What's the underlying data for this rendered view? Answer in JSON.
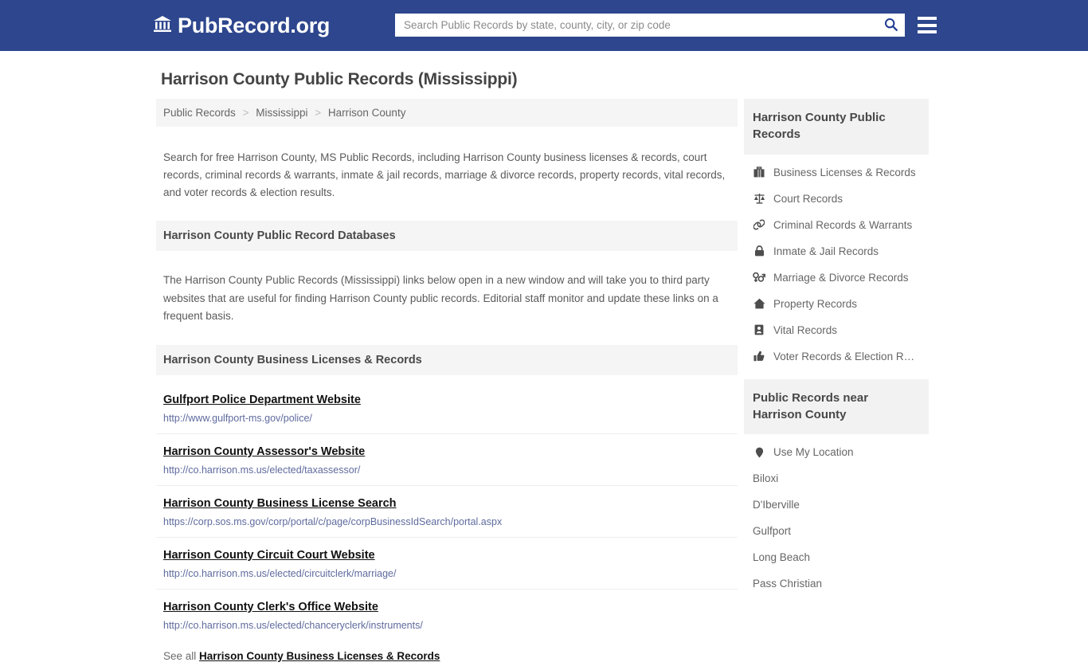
{
  "header": {
    "brand_name": "PubRecord.org",
    "brand_icon": "bank-icon",
    "search_placeholder": "Search Public Records by state, county, city, or zip code",
    "search_value": "",
    "search_icon": "search-icon",
    "menu_icon": "hamburger-menu-icon",
    "brand_color": "#2d468d"
  },
  "page": {
    "title": "Harrison County Public Records (Mississippi)"
  },
  "breadcrumb": {
    "items": [
      "Public Records",
      "Mississippi",
      "Harrison County"
    ],
    "separator": ">"
  },
  "intro": {
    "text": "Search for free Harrison County, MS Public Records, including Harrison County business licenses & records, court records, criminal records & warrants, inmate & jail records, marriage & divorce records, property records, vital records, and voter records & election results."
  },
  "databases_section": {
    "heading": "Harrison County Public Record Databases",
    "body": "The Harrison County Public Records (Mississippi) links below open in a new window and will take you to third party websites that are useful for finding Harrison County public records. Editorial staff monitor and update these links on a frequent basis."
  },
  "business_section": {
    "heading": "Harrison County Business Licenses & Records",
    "links": [
      {
        "title": "Gulfport Police Department Website",
        "url": "http://www.gulfport-ms.gov/police/"
      },
      {
        "title": "Harrison County Assessor's Website",
        "url": "http://co.harrison.ms.us/elected/taxassessor/"
      },
      {
        "title": "Harrison County Business License Search",
        "url": "https://corp.sos.ms.gov/corp/portal/c/page/corpBusinessIdSearch/portal.aspx"
      },
      {
        "title": "Harrison County Circuit Court Website",
        "url": "http://co.harrison.ms.us/elected/circuitclerk/marriage/"
      },
      {
        "title": "Harrison County Clerk's Office Website",
        "url": "http://co.harrison.ms.us/elected/chanceryclerk/instruments/"
      }
    ],
    "see_all_prefix": "See all",
    "see_all_link": "Harrison County Business Licenses & Records"
  },
  "sidebar": {
    "records_box": {
      "heading": "Harrison County Public Records",
      "items": [
        {
          "label": "Business Licenses & Records",
          "icon": "briefcase-icon"
        },
        {
          "label": "Court Records",
          "icon": "scales-icon"
        },
        {
          "label": "Criminal Records & Warrants",
          "icon": "handcuffs-icon"
        },
        {
          "label": "Inmate & Jail Records",
          "icon": "lock-icon"
        },
        {
          "label": "Marriage & Divorce Records",
          "icon": "venus-mars-icon"
        },
        {
          "label": "Property Records",
          "icon": "home-icon"
        },
        {
          "label": "Vital Records",
          "icon": "id-card-icon"
        },
        {
          "label": "Voter Records & Election R…",
          "icon": "thumbs-up-icon"
        }
      ]
    },
    "near_box": {
      "heading": "Public Records near Harrison County",
      "use_my_location": {
        "label": "Use My Location",
        "icon": "map-pin-icon"
      },
      "cities": [
        "Biloxi",
        "D'Iberville",
        "Gulfport",
        "Long Beach",
        "Pass Christian"
      ]
    }
  }
}
